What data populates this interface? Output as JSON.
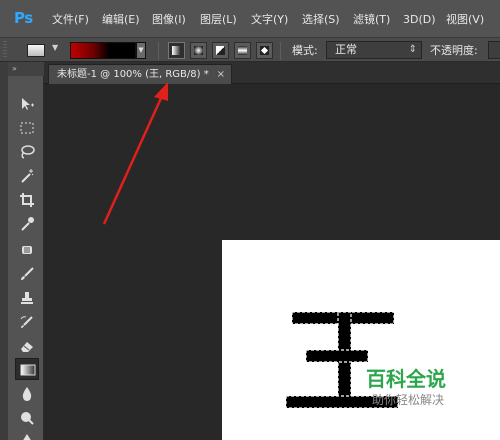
{
  "app": {
    "logo": "Ps",
    "accent": "#31a8ff"
  },
  "menu": [
    "文件(F)",
    "编辑(E)",
    "图像(I)",
    "图层(L)",
    "文字(Y)",
    "选择(S)",
    "滤镜(T)",
    "3D(D)",
    "视图(V)"
  ],
  "options": {
    "gradient_colors": [
      "#c00000",
      "#000000"
    ],
    "gradient_types": [
      "linear",
      "radial",
      "angle",
      "reflected",
      "diamond"
    ],
    "active_gradient_type": "linear",
    "mode_label": "模式:",
    "mode_value": "正常",
    "opacity_label": "不透明度:"
  },
  "toolbar": {
    "collapse_glyph": "»",
    "tools": [
      "move-icon",
      "marquee-icon",
      "lasso-icon",
      "magic-wand-icon",
      "crop-icon",
      "eyedropper-icon",
      "healing-brush-icon",
      "brush-icon",
      "clone-stamp-icon",
      "history-brush-icon",
      "eraser-icon",
      "gradient-icon",
      "blur-icon",
      "dodge-icon"
    ],
    "active_tool": "gradient-icon"
  },
  "document": {
    "tab_title": "未标题-1 @ 100% (王, RGB/8) *",
    "close_glyph": "×",
    "canvas_color": "#ffffff",
    "annotation_color": "#e0201b"
  },
  "watermark": {
    "title": "百科全说",
    "subtitle": "助你轻松解决",
    "color": "#2ca64b"
  }
}
